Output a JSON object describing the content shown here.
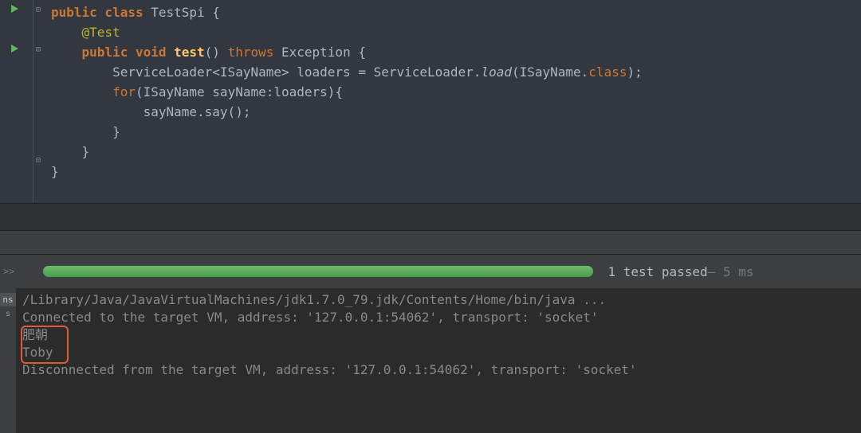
{
  "code": {
    "l1a": "public class ",
    "l1b": "TestSpi {",
    "l2a": "    ",
    "l2_ann": "@Test",
    "l3a": "    ",
    "l3_pub": "public void ",
    "l3_fn": "test",
    "l3b": "() ",
    "l3_throws": "throws ",
    "l3c": "Exception {",
    "l4a": "        ServiceLoader<ISayName> loaders = ServiceLoader.",
    "l4_load": "load",
    "l4b": "(ISayName.",
    "l4_class": "class",
    "l4c": ");",
    "l5a": "        ",
    "l5_for": "for",
    "l5b": "(ISayName sayName:loaders){",
    "l6a": "            sayName.say();",
    "l7a": "        }",
    "l8a": "    }",
    "l9a": "}"
  },
  "test": {
    "status": "1 test passed",
    "time": " – 5 ms"
  },
  "console": {
    "l1": "/Library/Java/JavaVirtualMachines/jdk1.7.0_79.jdk/Contents/Home/bin/java ...",
    "l2": "Connected to the target VM, address: '127.0.0.1:54062', transport: 'socket'",
    "l3": "肥朝",
    "l4": "Toby",
    "l5": "Disconnected from the target VM, address: '127.0.0.1:54062', transport: 'socket'"
  },
  "tabs": {
    "side": "ns",
    "chev": ">>"
  }
}
